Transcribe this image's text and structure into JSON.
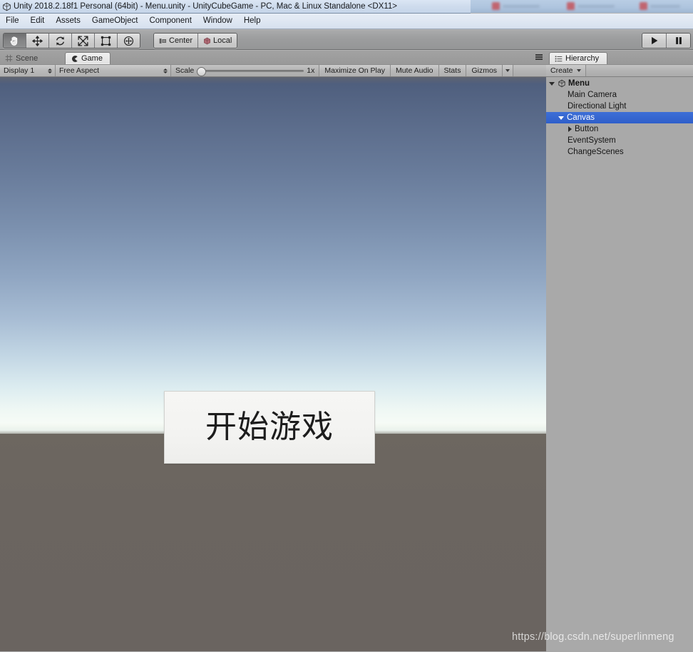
{
  "window": {
    "title": "Unity 2018.2.18f1 Personal (64bit) - Menu.unity - UnityCubeGame - PC, Mac & Linux Standalone <DX11>",
    "app_icon": "unity-logo-icon"
  },
  "menubar": {
    "items": [
      {
        "label": "File"
      },
      {
        "label": "Edit"
      },
      {
        "label": "Assets"
      },
      {
        "label": "GameObject"
      },
      {
        "label": "Component"
      },
      {
        "label": "Window"
      },
      {
        "label": "Help"
      }
    ]
  },
  "toolbar": {
    "transform_tools": [
      {
        "name": "hand-tool",
        "icon": "hand-icon",
        "active": true
      },
      {
        "name": "move-tool",
        "icon": "move-icon",
        "active": false
      },
      {
        "name": "rotate-tool",
        "icon": "rotate-icon",
        "active": false
      },
      {
        "name": "scale-tool",
        "icon": "scale-icon",
        "active": false
      },
      {
        "name": "rect-tool",
        "icon": "rect-transform-icon",
        "active": false
      },
      {
        "name": "transform-tool",
        "icon": "transform-icon",
        "active": false
      }
    ],
    "pivot_mode": "Center",
    "pivot_rotation": "Local",
    "play_label": "play-icon",
    "pause_label": "pause-icon"
  },
  "left_dock": {
    "tabs": [
      {
        "label": "Scene",
        "icon": "scene-grid-icon",
        "active": false
      },
      {
        "label": "Game",
        "icon": "game-pacman-icon",
        "active": true
      }
    ],
    "game_toolbar": {
      "display": "Display 1",
      "aspect": "Free Aspect",
      "scale_label": "Scale",
      "scale_value": "1x",
      "scale_percent": 0,
      "maximize_on_play": "Maximize On Play",
      "mute_audio": "Mute Audio",
      "stats": "Stats",
      "gizmos": "Gizmos"
    },
    "game_view": {
      "ui_button_label": "开始游戏",
      "sky_top_color": "#4a5a79",
      "sky_horizon_color": "#f6fbf6",
      "ground_color": "#6b6560"
    }
  },
  "hierarchy": {
    "tab_label": "Hierarchy",
    "tab_icon": "hierarchy-list-icon",
    "create_label": "Create",
    "selection_color": "#3366cc",
    "items": [
      {
        "label": "Menu",
        "depth": 0,
        "foldout": "open",
        "icon": "unity-scene-icon",
        "selected": false,
        "bold": true
      },
      {
        "label": "Main Camera",
        "depth": 1,
        "foldout": "none",
        "icon": "",
        "selected": false,
        "bold": false
      },
      {
        "label": "Directional Light",
        "depth": 1,
        "foldout": "none",
        "icon": "",
        "selected": false,
        "bold": false
      },
      {
        "label": "Canvas",
        "depth": 1,
        "foldout": "open",
        "icon": "",
        "selected": true,
        "bold": false
      },
      {
        "label": "Button",
        "depth": 2,
        "foldout": "closed",
        "icon": "",
        "selected": false,
        "bold": false
      },
      {
        "label": "EventSystem",
        "depth": 1,
        "foldout": "none",
        "icon": "",
        "selected": false,
        "bold": false
      },
      {
        "label": "ChangeScenes",
        "depth": 1,
        "foldout": "none",
        "icon": "",
        "selected": false,
        "bold": false
      }
    ]
  },
  "watermark": {
    "text": "https://blog.csdn.net/superlinmeng"
  }
}
